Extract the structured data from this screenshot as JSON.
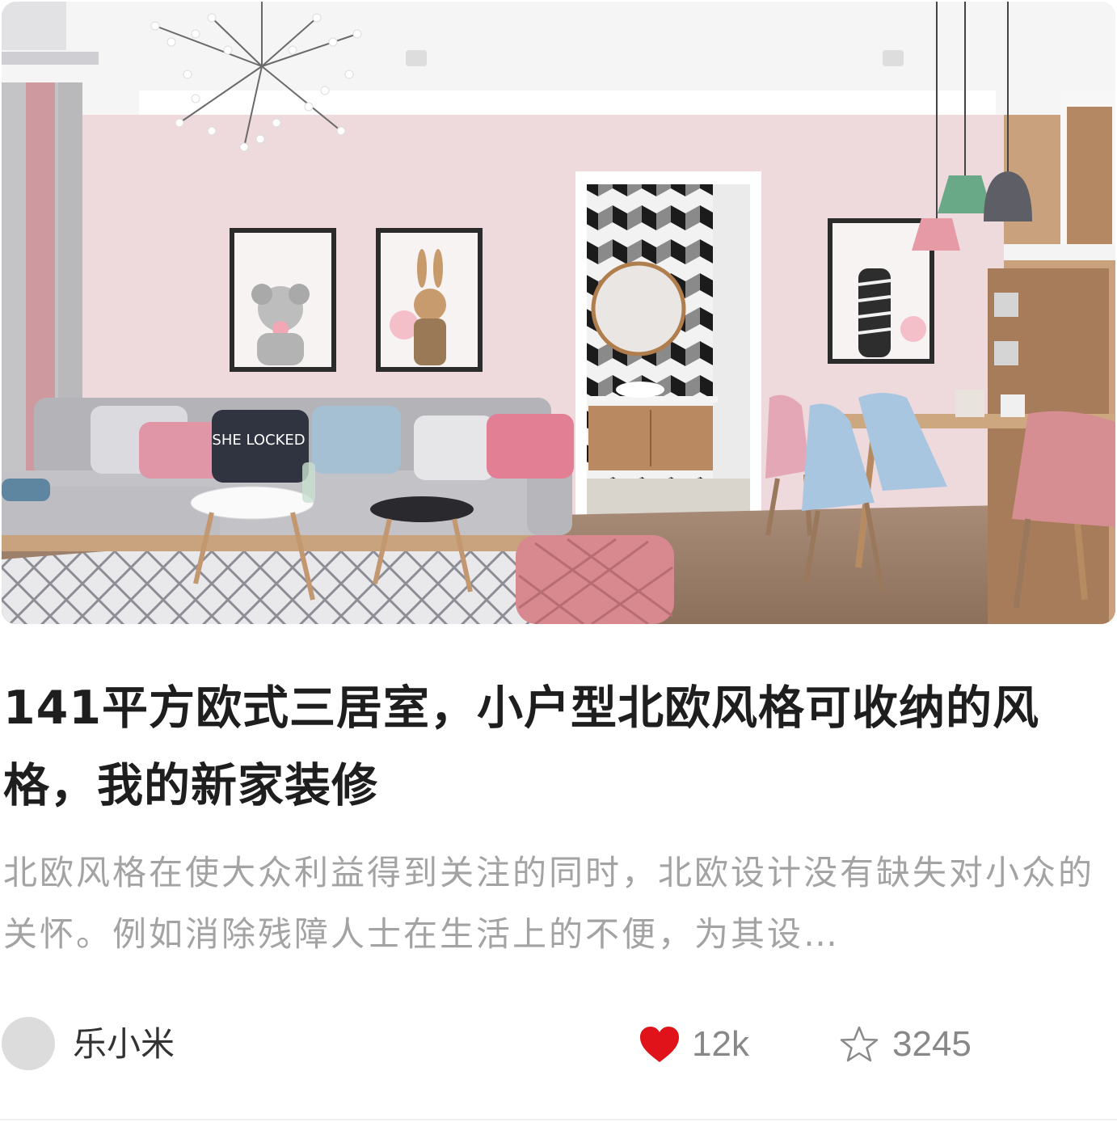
{
  "article": {
    "title": "141平方欧式三居室，小户型北欧风格可收纳的风格，我的新家装修",
    "summary": "北欧风格在使大众利益得到关注的同时，北欧设计没有缺失对小众的关怀。例如消除残障人士在生活上的不便，为其设…",
    "cover": {
      "pillow_text": "SHE LOCKED"
    }
  },
  "author": {
    "name": "乐小米"
  },
  "stats": {
    "likes": "12k",
    "favorites": "3245"
  },
  "icons": {
    "like": "heart-icon",
    "favorite": "star-icon"
  },
  "colors": {
    "like_active": "#e0121a",
    "text_primary": "#1e1e1e",
    "text_secondary": "#a3a3a3",
    "meta": "#888888"
  }
}
